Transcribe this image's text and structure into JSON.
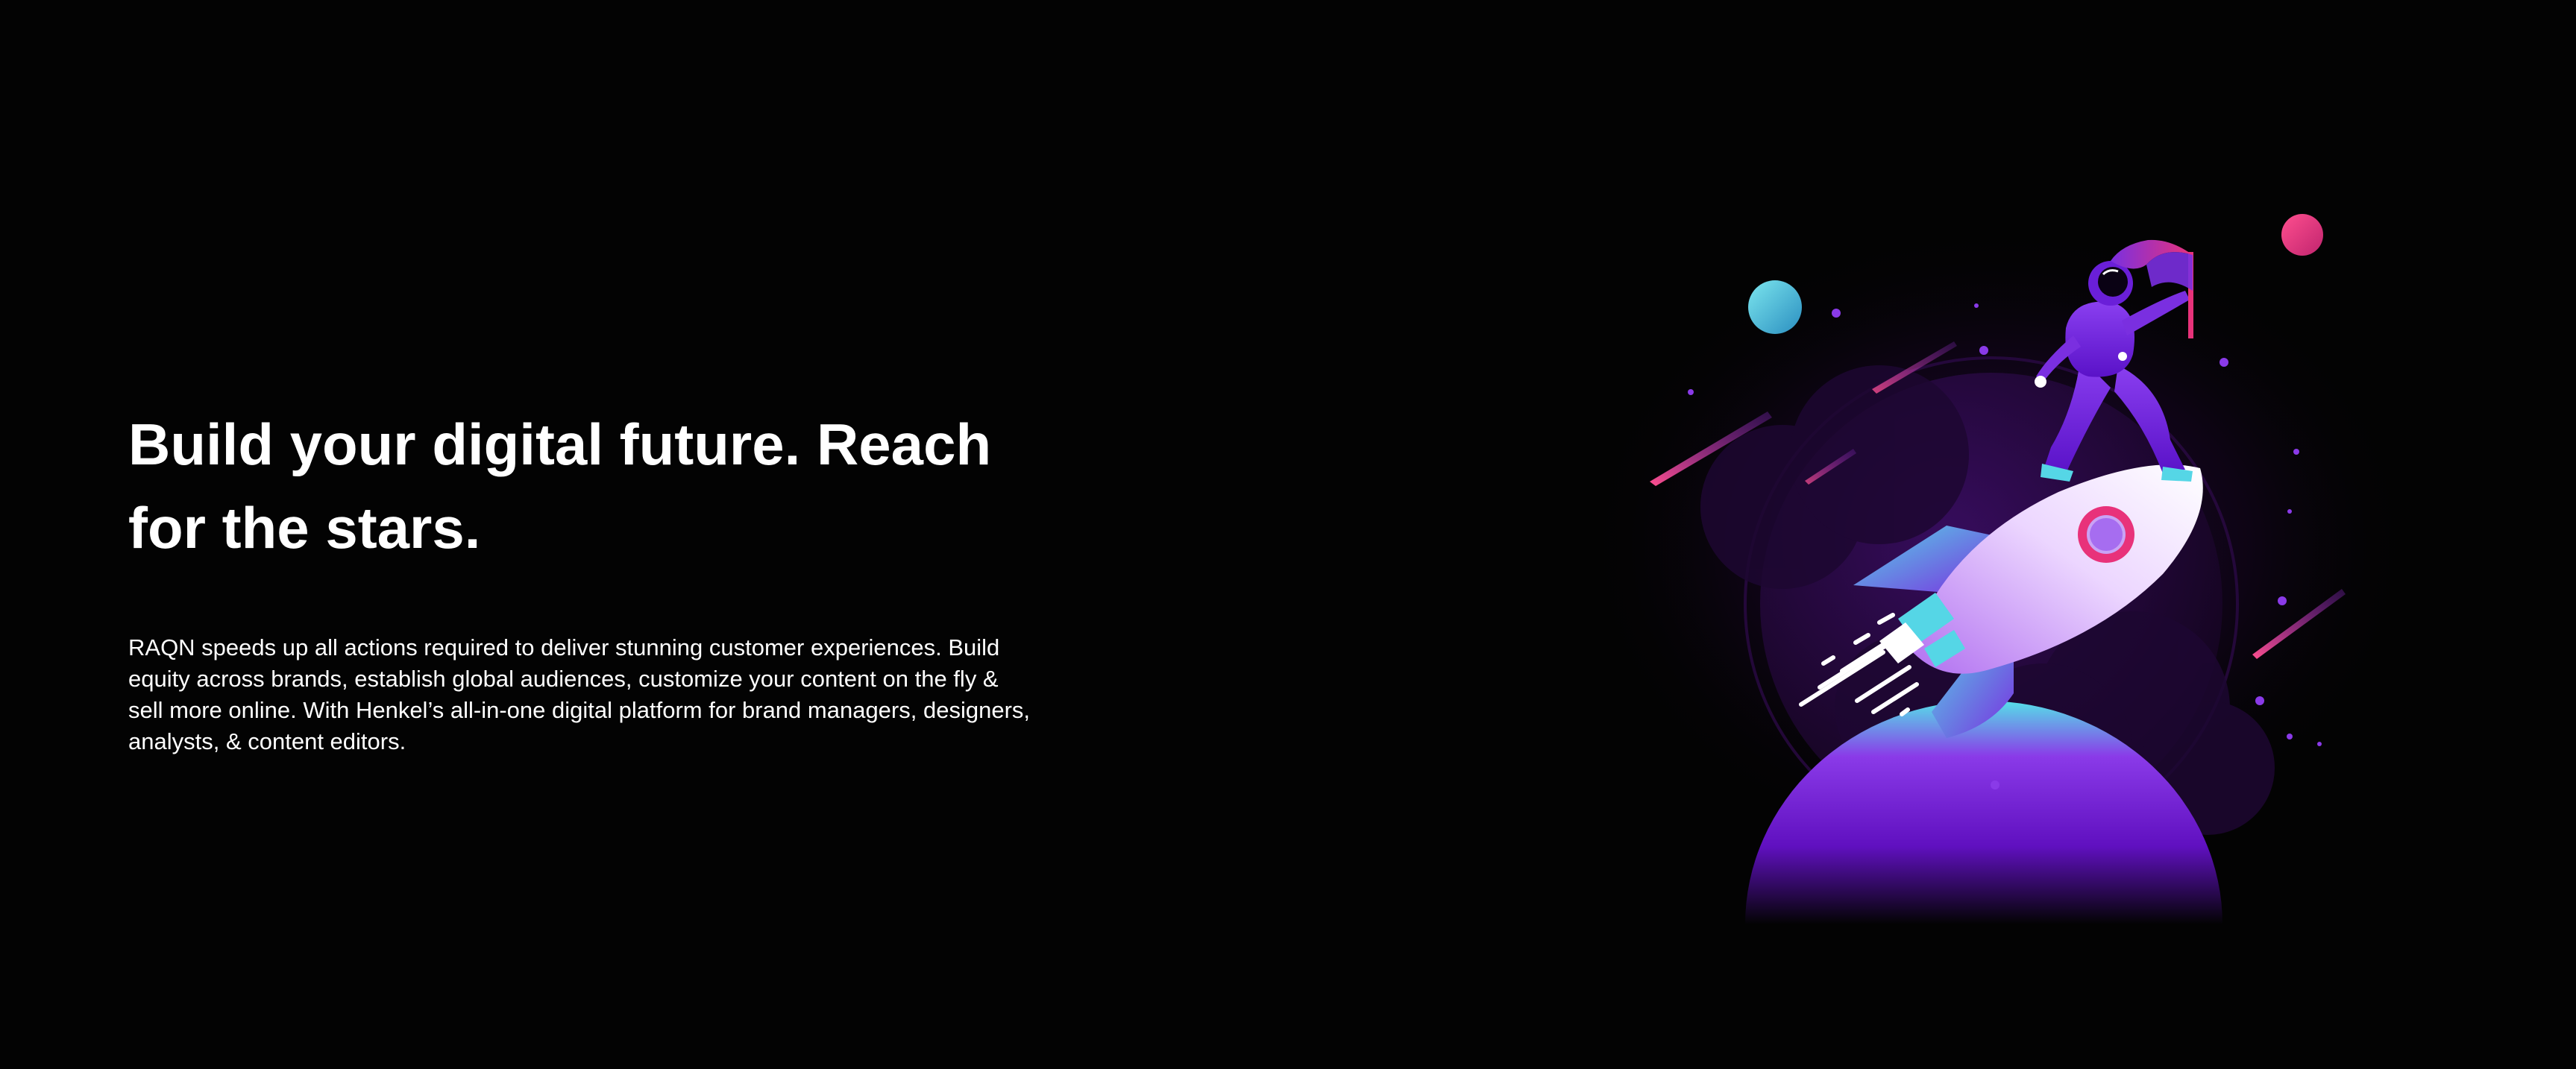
{
  "hero": {
    "title": "Build your digital future. Reach for the stars.",
    "description": "RAQN speeds up all actions required to deliver stunning customer experiences. Build equity across brands, establish global audiences, customize your content on the fly & sell more online. With Henkel’s all-in-one digital platform for brand managers, designers, analysts, & content editors."
  },
  "illustration": {
    "subject": "astronaut-on-rocket",
    "colors": {
      "background": "#030303",
      "purple": "#7b1fd6",
      "cyan": "#4fd1e0",
      "pink": "#e8327a",
      "rocket_body": "#f2e6ff"
    }
  }
}
